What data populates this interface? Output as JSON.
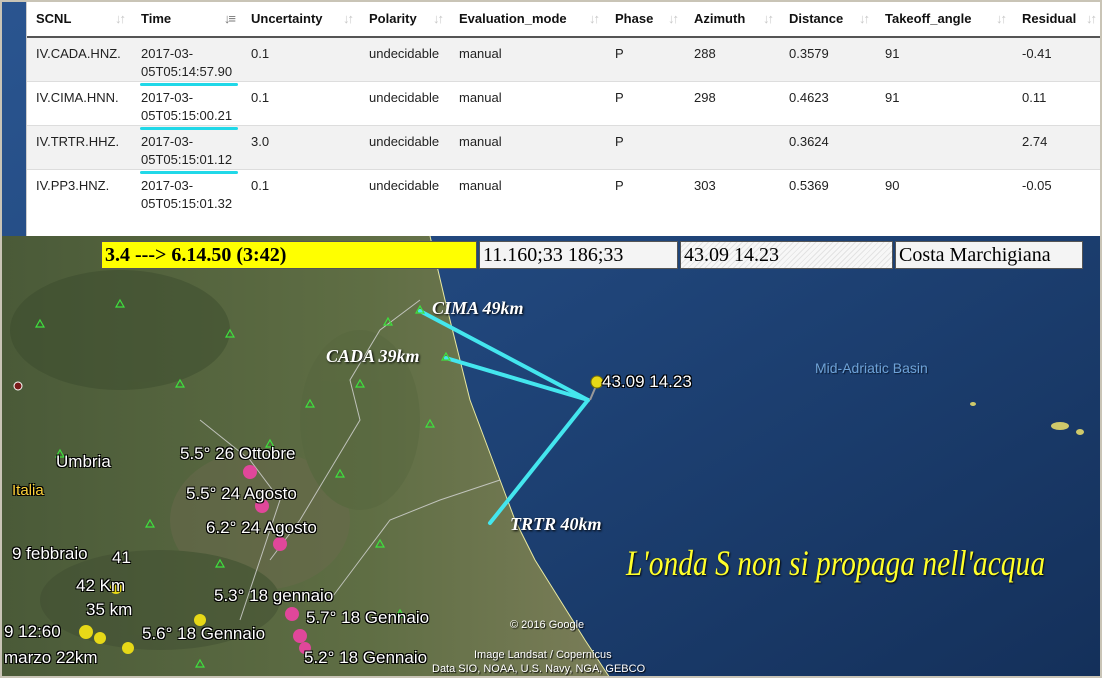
{
  "table": {
    "columns": [
      "SCNL",
      "Time",
      "Uncertainty",
      "Polarity",
      "Evaluation_mode",
      "Phase",
      "Azimuth",
      "Distance",
      "Takeoff_angle",
      "Residual"
    ],
    "rows": [
      {
        "scnl": "IV.CADA.HNZ.",
        "time1": "2017-03-",
        "time2": "05T05:14:57.90",
        "uncertainty": "0.1",
        "polarity": "undecidable",
        "mode": "manual",
        "phase": "P",
        "azimuth": "288",
        "distance": "0.3579",
        "takeoff": "91",
        "residual": "-0.41",
        "highlight": true
      },
      {
        "scnl": "IV.CIMA.HNN.",
        "time1": "2017-03-",
        "time2": "05T05:15:00.21",
        "uncertainty": "0.1",
        "polarity": "undecidable",
        "mode": "manual",
        "phase": "P",
        "azimuth": "298",
        "distance": "0.4623",
        "takeoff": "91",
        "residual": "0.11",
        "highlight": true
      },
      {
        "scnl": "IV.TRTR.HHZ.",
        "time1": "2017-03-",
        "time2": "05T05:15:01.12",
        "uncertainty": "3.0",
        "polarity": "undecidable",
        "mode": "manual",
        "phase": "P",
        "azimuth": "",
        "distance": "0.3624",
        "takeoff": "",
        "residual": "2.74",
        "highlight": true
      },
      {
        "scnl": "IV.PP3.HNZ.",
        "time1": "2017-03-",
        "time2": "05T05:15:01.32",
        "uncertainty": "0.1",
        "polarity": "undecidable",
        "mode": "manual",
        "phase": "P",
        "azimuth": "303",
        "distance": "0.5369",
        "takeoff": "90",
        "residual": "-0.05",
        "highlight": false
      }
    ]
  },
  "infobar": {
    "magnitude": "3.4 ---> 6.14.50 (3:42)",
    "mechanism": "11.160;33 186;33",
    "coords": "43.09 14.23",
    "region": "Costa Marchigiana"
  },
  "map": {
    "epicenter_label": "43.09 14.23",
    "stations": {
      "cima": "CIMA 49km",
      "cada": "CADA 39km",
      "trtr": "TRTR 40km"
    },
    "places": {
      "basin": "Mid-Adriatic Basin",
      "umbria": "Umbria",
      "italia": "Italia"
    },
    "quakes": [
      "5.5° 26 Ottobre",
      "5.5° 24 Agosto",
      "6.2° 24 Agosto",
      "5.3° 18 gennaio",
      "5.7° 18 Gennaio",
      "5.6° 18 Gennaio",
      "5.2° 18 Gennaio"
    ],
    "left_labels": [
      "9 febbraio",
      "41",
      "42 Km",
      "35 km",
      "9 12:60",
      "marzo 22km"
    ],
    "caption": "L'onda S non  si propaga nell'acqua",
    "credit_google": "© 2016 Google",
    "credit_image": "Image Landsat / Copernicus",
    "credit_data": "Data SIO, NOAA, U.S. Navy, NGA, GEBCO"
  },
  "colors": {
    "ray": "#44e6ee",
    "caption": "#ffff2a",
    "pin_pink": "#e0479a",
    "pin_yellow": "#e7d817",
    "underline": "#20d8e8"
  }
}
